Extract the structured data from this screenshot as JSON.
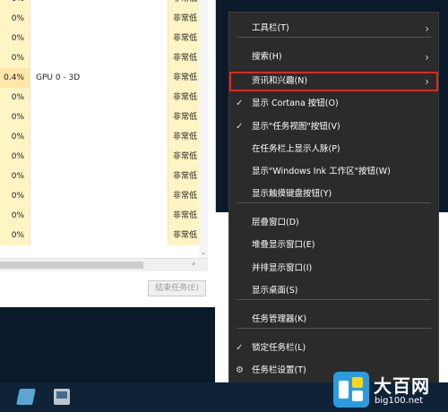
{
  "task_manager": {
    "rows": [
      {
        "cpu": "0%",
        "name": "",
        "priority": "非常低"
      },
      {
        "cpu": "0%",
        "name": "",
        "priority": "非常低"
      },
      {
        "cpu": "0%",
        "name": "",
        "priority": "非常低"
      },
      {
        "cpu": "0%",
        "name": "",
        "priority": "非常低"
      },
      {
        "cpu": "0.4%",
        "name": "GPU 0 - 3D",
        "priority": "非常低"
      },
      {
        "cpu": "0%",
        "name": "",
        "priority": "非常低"
      },
      {
        "cpu": "0%",
        "name": "",
        "priority": "非常低"
      },
      {
        "cpu": "0%",
        "name": "",
        "priority": "非常低"
      },
      {
        "cpu": "0%",
        "name": "",
        "priority": "非常低"
      },
      {
        "cpu": "0%",
        "name": "",
        "priority": "非常低"
      },
      {
        "cpu": "0%",
        "name": "",
        "priority": "非常低"
      },
      {
        "cpu": "0%",
        "name": "",
        "priority": "非常低"
      },
      {
        "cpu": "0%",
        "name": "",
        "priority": "非常低"
      }
    ],
    "end_task_label": "结束任务(E)"
  },
  "context_menu": {
    "items": [
      {
        "label": "工具栏(T)",
        "checked": false,
        "submenu": true
      },
      {
        "label": "搜索(H)",
        "checked": false,
        "submenu": true
      },
      {
        "label": "资讯和兴趣(N)",
        "checked": false,
        "submenu": true,
        "highlighted": true
      },
      {
        "label": "显示 Cortana 按钮(O)",
        "checked": true,
        "submenu": false
      },
      {
        "label": "显示\"任务视图\"按钮(V)",
        "checked": true,
        "submenu": false
      },
      {
        "label": "在任务栏上显示人脉(P)",
        "checked": false,
        "submenu": false
      },
      {
        "label": "显示\"Windows Ink 工作区\"按钮(W)",
        "checked": false,
        "submenu": false
      },
      {
        "label": "显示触摸键盘按钮(Y)",
        "checked": false,
        "submenu": false
      },
      {
        "label": "层叠窗口(D)",
        "checked": false,
        "submenu": false
      },
      {
        "label": "堆叠显示窗口(E)",
        "checked": false,
        "submenu": false
      },
      {
        "label": "并排显示窗口(I)",
        "checked": false,
        "submenu": false
      },
      {
        "label": "显示桌面(S)",
        "checked": false,
        "submenu": false
      },
      {
        "label": "任务管理器(K)",
        "checked": false,
        "submenu": false
      },
      {
        "label": "锁定任务栏(L)",
        "checked": true,
        "submenu": false
      },
      {
        "label": "任务栏设置(T)",
        "checked": false,
        "submenu": false,
        "gear": true
      }
    ],
    "glyphs": {
      "check": "✓",
      "arrow": "›",
      "gear": "⚙"
    },
    "highlight_color": "#e3271d"
  },
  "watermark": {
    "title": "大百网",
    "url": "big100.net"
  }
}
